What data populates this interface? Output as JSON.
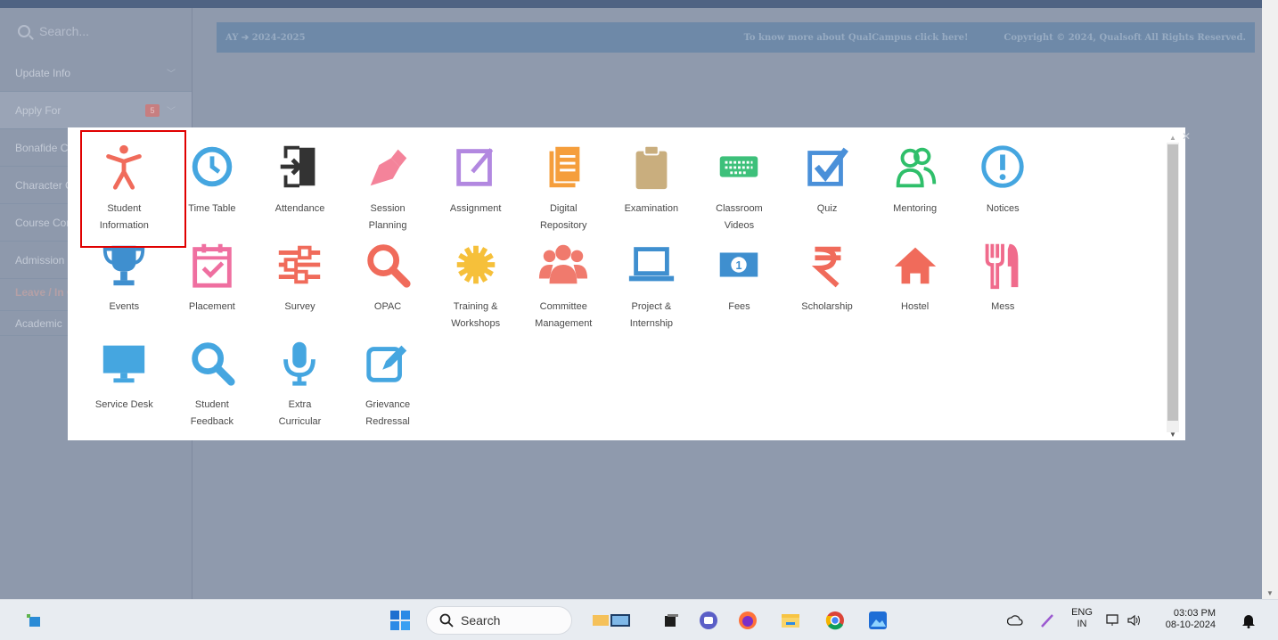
{
  "sidebar": {
    "search_placeholder": "Search...",
    "items": [
      {
        "label": "Update Info"
      },
      {
        "label": "Apply For",
        "badge": "5"
      },
      {
        "label": "Bonafide Certificate"
      },
      {
        "label": "Character Certificate"
      },
      {
        "label": "Course Completion Certificate"
      },
      {
        "label": "Admission"
      }
    ],
    "leave_label": "Leave / In Outdoor D",
    "academic_label": "Academic"
  },
  "banner": {
    "ay": "AY ➔ 2024-2025",
    "more": "To know more about QualCampus click here!",
    "copyright": "Copyright © 2024, Qualsoft All Rights Reserved."
  },
  "modules": [
    {
      "label": "Student\nInformation",
      "icon": "person-icon",
      "color": "#f06b5b"
    },
    {
      "label": "Time Table",
      "icon": "clock-icon",
      "color": "#45a6e0"
    },
    {
      "label": "Attendance",
      "icon": "sign-in-icon",
      "color": "#333333"
    },
    {
      "label": "Session\nPlanning",
      "icon": "pen-nib-icon",
      "color": "#f4839a"
    },
    {
      "label": "Assignment",
      "icon": "edit-square-icon",
      "color": "#b288e0"
    },
    {
      "label": "Digital\nRepository",
      "icon": "documents-icon",
      "color": "#f59e3c"
    },
    {
      "label": "Examination",
      "icon": "clipboard-icon",
      "color": "#c9ae7e"
    },
    {
      "label": "Classroom\nVideos",
      "icon": "keyboard-icon",
      "color": "#3dc07a"
    },
    {
      "label": "Quiz",
      "icon": "checkbox-icon",
      "color": "#4a90d9"
    },
    {
      "label": "Mentoring",
      "icon": "users-icon",
      "color": "#2fbf6a"
    },
    {
      "label": "Notices",
      "icon": "exclamation-icon",
      "color": "#45a6e0"
    },
    {
      "label": "Events",
      "icon": "trophy-icon",
      "color": "#3f8fcf"
    },
    {
      "label": "Placement",
      "icon": "calendar-check-icon",
      "color": "#ef6fa0"
    },
    {
      "label": "Survey",
      "icon": "sliders-icon",
      "color": "#f06b5b"
    },
    {
      "label": "OPAC",
      "icon": "search-icon",
      "color": "#f06b5b"
    },
    {
      "label": "Training &\nWorkshops",
      "icon": "sun-icon",
      "color": "#f6c03a"
    },
    {
      "label": "Committee\nManagement",
      "icon": "group-icon",
      "color": "#f07a6d"
    },
    {
      "label": "Project &\nInternship",
      "icon": "laptop-icon",
      "color": "#3f8fcf"
    },
    {
      "label": "Fees",
      "icon": "money-icon",
      "color": "#3f8fcf"
    },
    {
      "label": "Scholarship",
      "icon": "rupee-icon",
      "color": "#f06b5b"
    },
    {
      "label": "Hostel",
      "icon": "home-icon",
      "color": "#f06b5b"
    },
    {
      "label": "Mess",
      "icon": "cutlery-icon",
      "color": "#f06b8c"
    },
    {
      "label": "Service Desk",
      "icon": "monitor-icon",
      "color": "#45a6e0"
    },
    {
      "label": "Student\nFeedback",
      "icon": "search-icon",
      "color": "#45a6e0"
    },
    {
      "label": "Extra\nCurricular",
      "icon": "microphone-icon",
      "color": "#45a6e0"
    },
    {
      "label": "Grievance\nRedressal",
      "icon": "edit-icon",
      "color": "#45a6e0"
    }
  ],
  "taskbar": {
    "search_label": "Search",
    "lang_top": "ENG",
    "lang_bottom": "IN",
    "time": "03:03 PM",
    "date": "08-10-2024"
  }
}
